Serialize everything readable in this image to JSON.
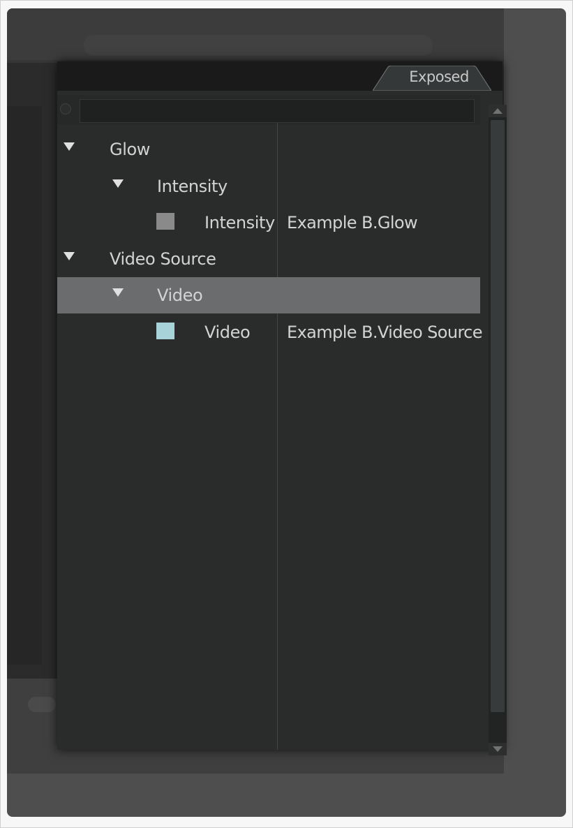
{
  "tab": {
    "label": "Exposed"
  },
  "filter": {
    "value": "",
    "placeholder": ""
  },
  "tree": {
    "rows": [
      {
        "label": "Glow",
        "target": "",
        "expanded": true,
        "selected": false
      },
      {
        "label": "Intensity",
        "target": "",
        "expanded": true,
        "selected": false
      },
      {
        "label": "Intensity",
        "target": "Example B.Glow",
        "swatch_color": "#8a8a8a",
        "selected": false
      },
      {
        "label": "Video Source",
        "target": "",
        "expanded": true,
        "selected": false
      },
      {
        "label": "Video",
        "target": "",
        "expanded": true,
        "selected": true
      },
      {
        "label": "Video",
        "target": "Example B.Video Source",
        "swatch_color": "#a8d4d9",
        "selected": false
      }
    ]
  },
  "colors": {
    "panel_background": "#2a2c2c",
    "selected_row": "#6b6c6e",
    "text": "#d3d3d3"
  }
}
